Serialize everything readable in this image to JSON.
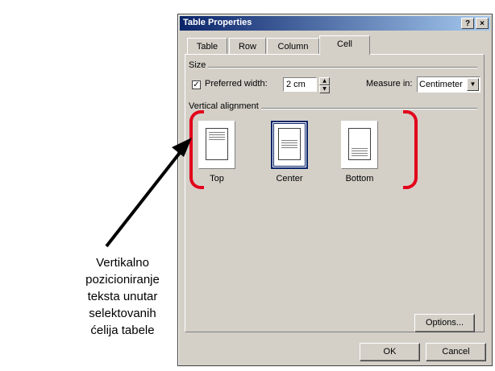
{
  "window": {
    "title": "Table Properties",
    "help_glyph": "?",
    "close_glyph": "×"
  },
  "tabs": [
    {
      "label": "Table"
    },
    {
      "label": "Row"
    },
    {
      "label": "Column"
    },
    {
      "label": "Cell",
      "active": true
    }
  ],
  "size_group": {
    "label": "Size",
    "preferred_width": {
      "checked": true,
      "label": "Preferred width:",
      "value": "2 cm"
    },
    "measure_in": {
      "label": "Measure in:",
      "value": "Centimeter"
    }
  },
  "vertical_alignment": {
    "label": "Vertical alignment",
    "options": [
      {
        "label": "Top",
        "selected": false
      },
      {
        "label": "Center",
        "selected": true
      },
      {
        "label": "Bottom",
        "selected": false
      }
    ]
  },
  "buttons": {
    "options": "Options...",
    "ok": "OK",
    "cancel": "Cancel"
  },
  "annotation": {
    "caption_lines": [
      "Vertikalno",
      "pozicioniranje",
      "teksta unutar",
      "selektovanih",
      "ćelija tabele"
    ],
    "highlight_color": "#e3001b",
    "arrow_color": "#000000"
  }
}
